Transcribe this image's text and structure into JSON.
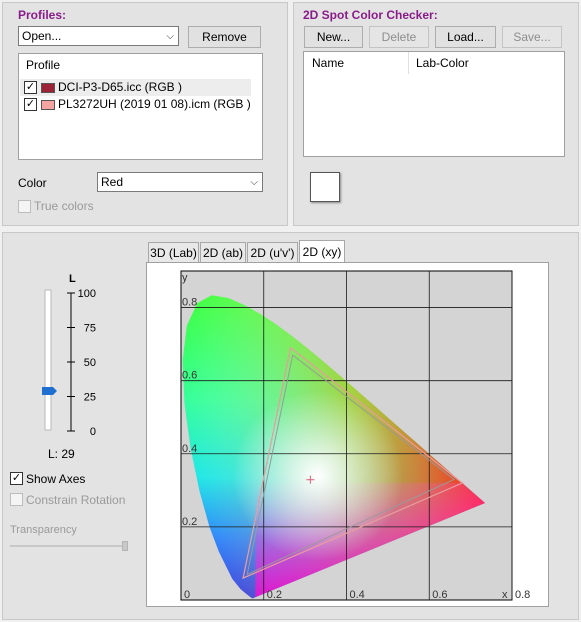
{
  "profiles": {
    "title": "Profiles:",
    "dropdown_value": "Open...",
    "remove_label": "Remove",
    "list_header": "Profile",
    "items": [
      {
        "name": "DCI-P3-D65.icc (RGB )",
        "checked": true,
        "swatch": "#9b2335"
      },
      {
        "name": "PL3272UH (2019 01 08).icm (RGB )",
        "checked": true,
        "swatch": "#f4a3a3"
      }
    ],
    "color_label": "Color",
    "color_value": "Red",
    "true_colors_label": "True colors"
  },
  "spot_checker": {
    "title": "2D Spot Color Checker:",
    "buttons": {
      "new": "New...",
      "delete": "Delete",
      "load": "Load...",
      "save": "Save..."
    },
    "columns": {
      "name": "Name",
      "lab": "Lab-Color"
    }
  },
  "lightness": {
    "axis_label": "L",
    "ticks": [
      "100",
      "75",
      "50",
      "25",
      "0"
    ],
    "value": 29,
    "value_text": "L: 29",
    "accent": "#1e6fd0"
  },
  "options": {
    "show_axes_label": "Show Axes",
    "show_axes_checked": true,
    "constrain_rotation_label": "Constrain Rotation",
    "transparency_label": "Transparency"
  },
  "tabs": [
    {
      "label": "3D (Lab)",
      "active": false
    },
    {
      "label": "2D (ab)",
      "active": false
    },
    {
      "label": "2D (u'v')",
      "active": false
    },
    {
      "label": "2D (xy)",
      "active": true
    }
  ],
  "chart_data": {
    "type": "scatter",
    "x_axis_label": "x",
    "y_axis_label": "y",
    "xlim": [
      0,
      0.8
    ],
    "ylim": [
      0,
      0.9
    ],
    "x_ticks": [
      "0",
      "0.2",
      "0.4",
      "0.6",
      "0.8"
    ],
    "y_ticks": [
      "0.2",
      "0.4",
      "0.6",
      "0.8"
    ],
    "grid": true,
    "series": [
      {
        "points": [
          [
            0.68,
            0.32
          ],
          [
            0.265,
            0.69
          ],
          [
            0.15,
            0.06
          ]
        ],
        "color": "#d43a6a"
      },
      {
        "points": [
          [
            0.68,
            0.32
          ],
          [
            0.265,
            0.69
          ],
          [
            0.15,
            0.06
          ]
        ],
        "color": "#e8a0a0"
      }
    ],
    "white_point": [
      0.3127,
      0.329
    ]
  }
}
